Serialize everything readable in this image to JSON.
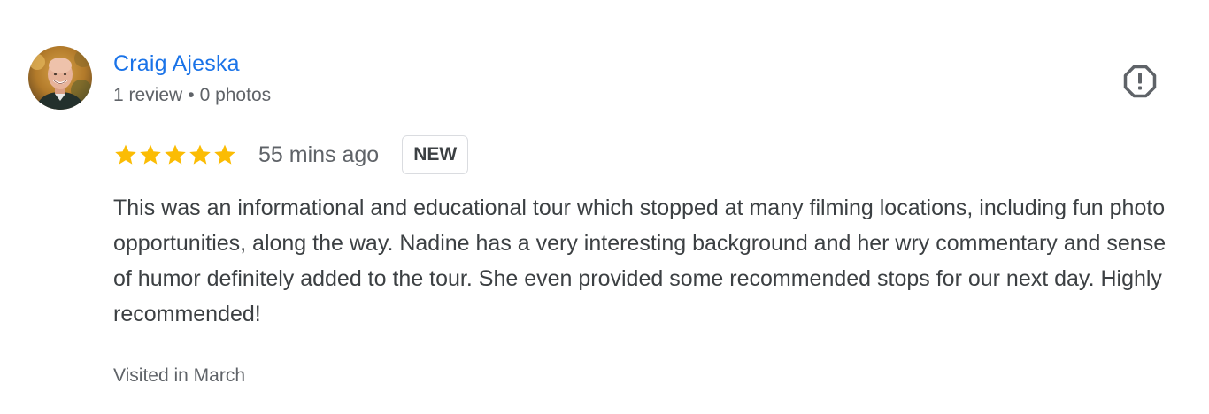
{
  "review": {
    "author": {
      "name": "Craig Ajeska",
      "review_count": "1 review",
      "separator": "•",
      "photo_count": "0 photos"
    },
    "rating": {
      "stars": 5,
      "max_stars": 5,
      "star_color": "#fbbc04"
    },
    "time_ago": "55 mins ago",
    "badge": "NEW",
    "text": "This was an informational and educational tour which stopped at many filming locations, including fun photo opportunities, along the way. Nadine has a very interesting background and her wry commentary and sense of humor definitely added to the tour. She even provided some recommended stops for our next day. Highly recommended!",
    "visited": "Visited in March",
    "icons": {
      "report": "report-flag-icon",
      "star": "star-icon",
      "avatar": "user-avatar"
    }
  },
  "colors": {
    "link": "#1a73e8",
    "secondary_text": "#5f6368",
    "body_text": "#3c4043",
    "badge_border": "#dadce0"
  }
}
